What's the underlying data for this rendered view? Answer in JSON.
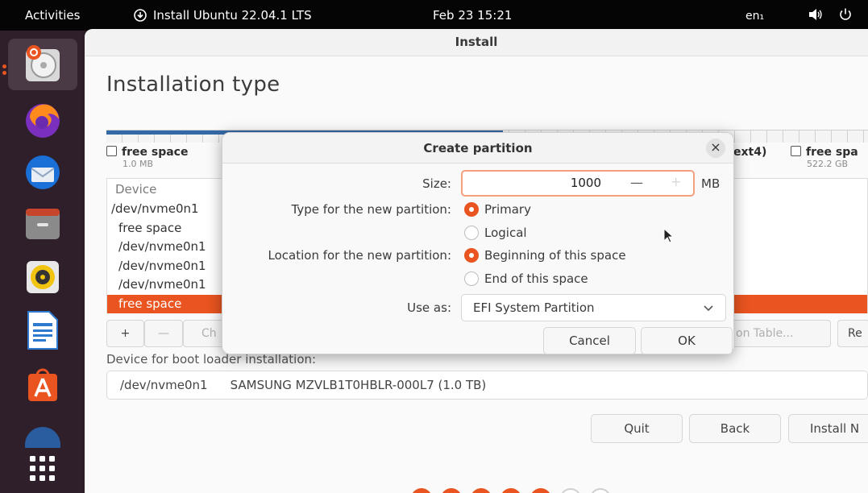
{
  "topbar": {
    "activities": "Activities",
    "app_title": "Install Ubuntu 22.04.1 LTS",
    "clock": "Feb 23  15:21",
    "keyboard_layout": "en₁"
  },
  "dock": {
    "apps": [
      "ubuntu-installer",
      "firefox",
      "thunderbird",
      "files",
      "rhythmbox",
      "libreoffice-writer",
      "app-center",
      "help",
      "show-apps"
    ]
  },
  "window": {
    "title": "Install",
    "page_title": "Installation type"
  },
  "partition_legend": [
    {
      "name": "free space",
      "size": "1.0 MB"
    },
    {
      "name": "ext4)",
      "size": ""
    },
    {
      "name": "free spa",
      "size": "522.2 GB"
    }
  ],
  "device_list": {
    "header": "Device",
    "rows": [
      "/dev/nvme0n1",
      "free space",
      "/dev/nvme0n1",
      "/dev/nvme0n1",
      "/dev/nvme0n1",
      "free space"
    ]
  },
  "toolbar": {
    "add": "+",
    "remove": "—",
    "change": "Ch",
    "new_table": "on Table...",
    "revert": "Re"
  },
  "boot_loader": {
    "label": "Device for boot loader installation:",
    "device": "/dev/nvme0n1",
    "model": "SAMSUNG MZVLB1T0HBLR-000L7 (1.0 TB)"
  },
  "nav": {
    "quit": "Quit",
    "back": "Back",
    "install": "Install N"
  },
  "dialog": {
    "title": "Create partition",
    "close": "×",
    "size_label": "Size:",
    "size_value": "1000",
    "size_unit": "MB",
    "type_label": "Type for the new partition:",
    "type_primary": "Primary",
    "type_logical": "Logical",
    "location_label": "Location for the new partition:",
    "location_beginning": "Beginning of this space",
    "location_end": "End of this space",
    "useas_label": "Use as:",
    "useas_value": "EFI System Partition",
    "cancel": "Cancel",
    "ok": "OK"
  },
  "colors": {
    "accent": "#e95420",
    "partition_blue": "#3469a8"
  }
}
